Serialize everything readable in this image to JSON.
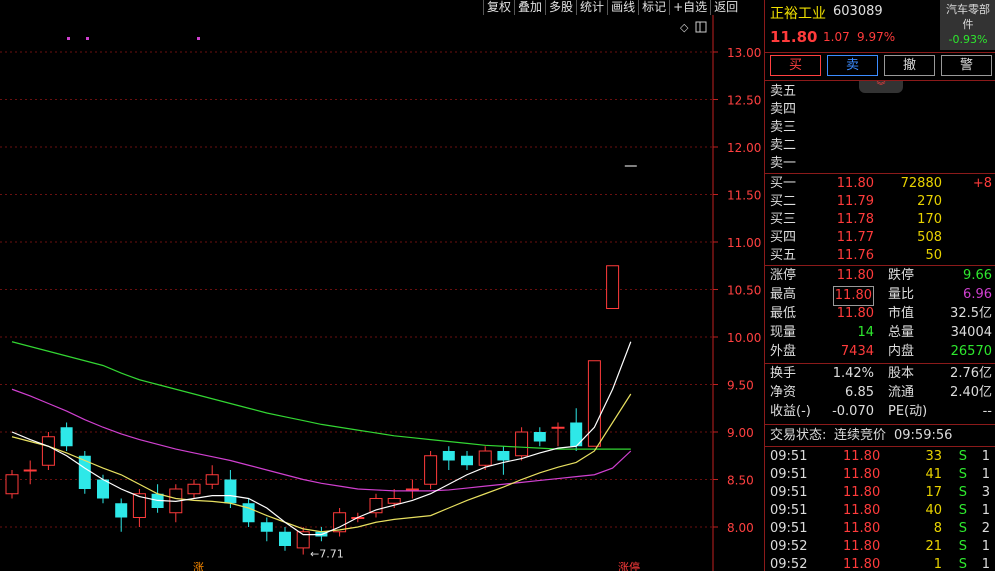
{
  "toolbar": [
    "复权",
    "叠加",
    "多股",
    "统计",
    "画线",
    "标记",
    "+自选",
    "返回"
  ],
  "stock": {
    "name": "正裕工业",
    "code": "603089",
    "industry_line1": "汽车零部",
    "industry_line2": "件",
    "industry_change": "-0.93%",
    "price": "11.80",
    "change": "1.07",
    "change_pct": "9.97%"
  },
  "trade_buttons": {
    "buy": "买",
    "sell": "卖",
    "cancel": "撤",
    "alert": "警"
  },
  "collapse_icon": "double-chevron-down",
  "order_book": {
    "asks": [
      {
        "label": "卖五"
      },
      {
        "label": "卖四"
      },
      {
        "label": "卖三"
      },
      {
        "label": "卖二"
      },
      {
        "label": "卖一"
      }
    ],
    "bids": [
      {
        "label": "买一",
        "price": "11.80",
        "vol": "72880",
        "delta": "+8"
      },
      {
        "label": "买二",
        "price": "11.79",
        "vol": "270",
        "delta": ""
      },
      {
        "label": "买三",
        "price": "11.78",
        "vol": "170",
        "delta": ""
      },
      {
        "label": "买四",
        "price": "11.77",
        "vol": "508",
        "delta": ""
      },
      {
        "label": "买五",
        "price": "11.76",
        "vol": "50",
        "delta": ""
      }
    ]
  },
  "stats": [
    {
      "l1": "涨停",
      "v1": "11.80",
      "l2": "跌停",
      "v2": "9.66"
    },
    {
      "l1": "最高",
      "v1": "11.80",
      "l2": "量比",
      "v2": "6.96"
    },
    {
      "l1": "最低",
      "v1": "11.80",
      "l2": "市值",
      "v2": "32.5亿"
    },
    {
      "l1": "现量",
      "v1": "14",
      "l2": "总量",
      "v2": "34004"
    },
    {
      "l1": "外盘",
      "v1": "7434",
      "l2": "内盘",
      "v2": "26570"
    }
  ],
  "stats2": [
    {
      "l1": "换手",
      "v1": "1.42%",
      "l2": "股本",
      "v2": "2.76亿"
    },
    {
      "l1": "净资",
      "v1": "6.85",
      "l2": "流通",
      "v2": "2.40亿"
    },
    {
      "l1": "收益(-)",
      "v1": "-0.070",
      "l2": "PE(动)",
      "v2": "--"
    }
  ],
  "status": {
    "label": "交易状态:",
    "value": "连续竞价",
    "time": "09:59:56"
  },
  "ticks": [
    {
      "t": "09:51",
      "p": "11.80",
      "v": "33",
      "s": "S",
      "n": "1"
    },
    {
      "t": "09:51",
      "p": "11.80",
      "v": "41",
      "s": "S",
      "n": "1"
    },
    {
      "t": "09:51",
      "p": "11.80",
      "v": "17",
      "s": "S",
      "n": "3"
    },
    {
      "t": "09:51",
      "p": "11.80",
      "v": "40",
      "s": "S",
      "n": "1"
    },
    {
      "t": "09:51",
      "p": "11.80",
      "v": "8",
      "s": "S",
      "n": "2"
    },
    {
      "t": "09:52",
      "p": "11.80",
      "v": "21",
      "s": "S",
      "n": "1"
    },
    {
      "t": "09:52",
      "p": "11.80",
      "v": "1",
      "s": "S",
      "n": "1"
    }
  ],
  "chart_data": {
    "type": "candlestick",
    "y_ticks": [
      "13.00",
      "12.50",
      "12.00",
      "11.50",
      "11.00",
      "10.50",
      "10.00",
      "9.50",
      "9.00",
      "8.50",
      "8.00"
    ],
    "ylim": [
      7.75,
      13.15
    ],
    "min_label": "7.71",
    "bottom_labels": [
      "涨",
      "涨停"
    ],
    "top_right_icons": [
      "diamond-icon",
      "split-icon"
    ],
    "candles": [
      {
        "o": 8.35,
        "c": 8.55,
        "h": 8.6,
        "l": 8.3
      },
      {
        "o": 8.6,
        "c": 8.6,
        "h": 8.7,
        "l": 8.45
      },
      {
        "o": 8.65,
        "c": 8.95,
        "h": 9.0,
        "l": 8.6
      },
      {
        "o": 9.05,
        "c": 8.85,
        "h": 9.1,
        "l": 8.8
      },
      {
        "o": 8.75,
        "c": 8.4,
        "h": 8.8,
        "l": 8.35
      },
      {
        "o": 8.5,
        "c": 8.3,
        "h": 8.55,
        "l": 8.25
      },
      {
        "o": 8.25,
        "c": 8.1,
        "h": 8.3,
        "l": 7.95
      },
      {
        "o": 8.1,
        "c": 8.35,
        "h": 8.4,
        "l": 8.0
      },
      {
        "o": 8.35,
        "c": 8.2,
        "h": 8.45,
        "l": 8.15
      },
      {
        "o": 8.15,
        "c": 8.4,
        "h": 8.45,
        "l": 8.05
      },
      {
        "o": 8.35,
        "c": 8.45,
        "h": 8.5,
        "l": 8.3
      },
      {
        "o": 8.45,
        "c": 8.55,
        "h": 8.65,
        "l": 8.4
      },
      {
        "o": 8.5,
        "c": 8.25,
        "h": 8.6,
        "l": 8.2
      },
      {
        "o": 8.25,
        "c": 8.05,
        "h": 8.3,
        "l": 8.0
      },
      {
        "o": 8.05,
        "c": 7.95,
        "h": 8.1,
        "l": 7.85
      },
      {
        "o": 7.95,
        "c": 7.8,
        "h": 8.0,
        "l": 7.75
      },
      {
        "o": 7.78,
        "c": 7.95,
        "h": 8.0,
        "l": 7.71
      },
      {
        "o": 7.95,
        "c": 7.9,
        "h": 8.0,
        "l": 7.85
      },
      {
        "o": 7.95,
        "c": 8.15,
        "h": 8.2,
        "l": 7.9
      },
      {
        "o": 8.1,
        "c": 8.1,
        "h": 8.15,
        "l": 8.05
      },
      {
        "o": 8.15,
        "c": 8.3,
        "h": 8.35,
        "l": 8.1
      },
      {
        "o": 8.25,
        "c": 8.3,
        "h": 8.4,
        "l": 8.2
      },
      {
        "o": 8.4,
        "c": 8.4,
        "h": 8.5,
        "l": 8.3
      },
      {
        "o": 8.45,
        "c": 8.75,
        "h": 8.8,
        "l": 8.4
      },
      {
        "o": 8.8,
        "c": 8.7,
        "h": 8.85,
        "l": 8.6
      },
      {
        "o": 8.75,
        "c": 8.65,
        "h": 8.8,
        "l": 8.6
      },
      {
        "o": 8.65,
        "c": 8.8,
        "h": 8.85,
        "l": 8.6
      },
      {
        "o": 8.8,
        "c": 8.7,
        "h": 8.85,
        "l": 8.55
      },
      {
        "o": 8.75,
        "c": 9.0,
        "h": 9.05,
        "l": 8.7
      },
      {
        "o": 9.0,
        "c": 8.9,
        "h": 9.05,
        "l": 8.85
      },
      {
        "o": 9.05,
        "c": 9.05,
        "h": 9.1,
        "l": 8.85
      },
      {
        "o": 9.1,
        "c": 8.85,
        "h": 9.25,
        "l": 8.8
      },
      {
        "o": 8.85,
        "c": 9.75,
        "h": 9.75,
        "l": 8.85
      },
      {
        "o": 10.3,
        "c": 10.75,
        "h": 10.75,
        "l": 10.3
      },
      {
        "o": 11.8,
        "c": 11.8,
        "h": 11.8,
        "l": 11.8
      }
    ],
    "ma_lines": [
      {
        "name": "MA-green",
        "color": "#33d633",
        "values": [
          9.95,
          9.9,
          9.85,
          9.8,
          9.75,
          9.7,
          9.62,
          9.55,
          9.5,
          9.45,
          9.4,
          9.35,
          9.3,
          9.25,
          9.2,
          9.16,
          9.12,
          9.08,
          9.05,
          9.02,
          8.99,
          8.96,
          8.94,
          8.92,
          8.9,
          8.88,
          8.86,
          8.85,
          8.84,
          8.83,
          8.82,
          8.82,
          8.82,
          8.82,
          8.82
        ]
      },
      {
        "name": "MA-magenta",
        "color": "#d040d0",
        "values": [
          9.45,
          9.38,
          9.3,
          9.22,
          9.13,
          9.05,
          8.98,
          8.92,
          8.87,
          8.82,
          8.78,
          8.74,
          8.7,
          8.65,
          8.6,
          8.55,
          8.5,
          8.46,
          8.43,
          8.4,
          8.39,
          8.38,
          8.38,
          8.38,
          8.39,
          8.41,
          8.43,
          8.45,
          8.47,
          8.49,
          8.51,
          8.53,
          8.55,
          8.62,
          8.8
        ]
      },
      {
        "name": "MA-yellow",
        "color": "#e8e060",
        "values": [
          8.95,
          8.9,
          8.85,
          8.78,
          8.7,
          8.62,
          8.55,
          8.45,
          8.35,
          8.3,
          8.28,
          8.27,
          8.25,
          8.2,
          8.12,
          8.05,
          7.98,
          7.95,
          7.97,
          8.0,
          8.05,
          8.08,
          8.1,
          8.12,
          8.2,
          8.28,
          8.35,
          8.42,
          8.5,
          8.57,
          8.63,
          8.68,
          8.8,
          9.1,
          9.4
        ]
      },
      {
        "name": "MA-white",
        "color": "#ffffff",
        "values": [
          9.0,
          8.92,
          8.85,
          8.75,
          8.62,
          8.5,
          8.4,
          8.32,
          8.28,
          8.27,
          8.3,
          8.33,
          8.33,
          8.3,
          8.2,
          8.05,
          7.92,
          7.92,
          8.0,
          8.1,
          8.18,
          8.23,
          8.28,
          8.35,
          8.45,
          8.55,
          8.63,
          8.68,
          8.72,
          8.78,
          8.83,
          8.85,
          9.05,
          9.45,
          9.95
        ]
      }
    ]
  }
}
